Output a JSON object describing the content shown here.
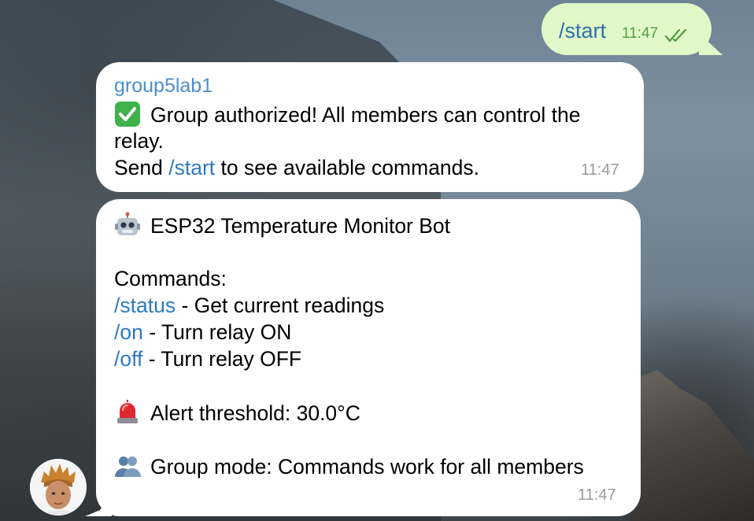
{
  "outgoing": {
    "text": "/start",
    "time": "11:47",
    "status_icon": "double-check-icon"
  },
  "messages": [
    {
      "sender": "group5lab1",
      "lines": [
        {
          "emoji": "check-mark-emoji",
          "text": "Group authorized! All members can control the"
        },
        {
          "text": "relay."
        },
        {
          "prefix": "Send ",
          "link": "/start",
          "suffix": " to see available commands."
        }
      ],
      "time": "11:47"
    },
    {
      "lines": [
        {
          "emoji": "robot-emoji",
          "text": "ESP32 Temperature Monitor Bot"
        },
        {
          "text": "Commands:"
        },
        {
          "link": "/status",
          "suffix": " - Get current readings"
        },
        {
          "link": "/on",
          "suffix": " - Turn relay ON"
        },
        {
          "link": "/off",
          "suffix": " - Turn relay OFF"
        },
        {
          "emoji": "siren-emoji",
          "text": "Alert threshold: 30.0°C"
        },
        {
          "emoji": "group-emoji",
          "text": "Group mode: Commands work for all members"
        }
      ],
      "time": "11:47"
    }
  ],
  "colors": {
    "outgoing_bubble": "#e1f8c9",
    "incoming_bubble": "#ffffff",
    "link": "#2f79c2",
    "sender_name": "#4a8fcf",
    "outgoing_time": "#4f9f3f",
    "incoming_time": "#9a9a9a"
  }
}
